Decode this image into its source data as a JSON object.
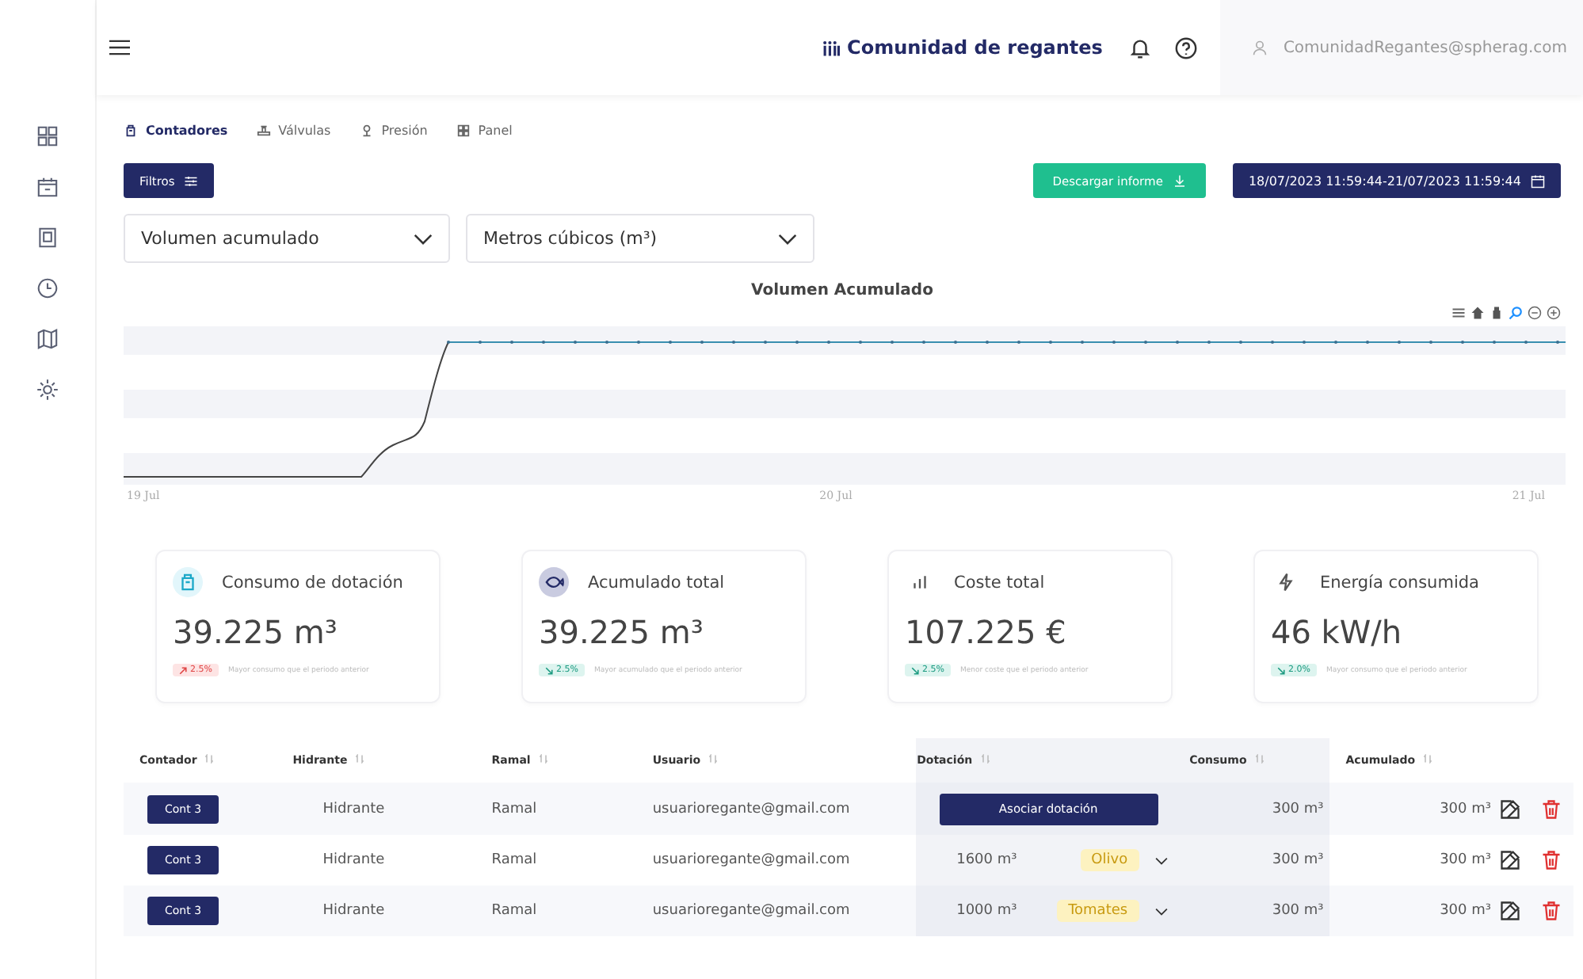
{
  "header": {
    "org": "Comunidad de regantes",
    "user": "ComunidadRegantes@spherag.com"
  },
  "tabs": [
    {
      "label": "Contadores",
      "selected": true
    },
    {
      "label": "Válvulas",
      "selected": false
    },
    {
      "label": "Presión",
      "selected": false
    },
    {
      "label": "Panel",
      "selected": false
    }
  ],
  "toolbar": {
    "filters": "Filtros",
    "download": "Descargar informe",
    "date_range": "18/07/2023 11:59:44-21/07/2023 11:59:44"
  },
  "selects": [
    {
      "value": "Volumen acumulado"
    },
    {
      "value": "Metros cúbicos (m³)"
    }
  ],
  "chart": {
    "title": "Volumen Acumulado",
    "x_labels": [
      "19 Jul",
      "20 Jul",
      "21 Jul"
    ]
  },
  "cards": [
    {
      "title": "Consumo de dotación",
      "value": "39.225 m³",
      "rising": true,
      "badge": "2.5%",
      "note": "Mayor consumo que el periodo anterior"
    },
    {
      "title": "Acumulado total",
      "value": "39.225 m³",
      "rising": false,
      "badge": "2.5%",
      "note": "Mayor acumulado que el periodo anterior"
    },
    {
      "title": "Coste total",
      "value": "107.225 €",
      "rising": false,
      "badge": "2.5%",
      "note": "Menor coste que el periodo anterior"
    },
    {
      "title": "Energía consumida",
      "value": "46 kW/h",
      "rising": false,
      "badge": "2.0%",
      "note": "Mayor consumo que el periodo anterior"
    }
  ],
  "table": {
    "columns": [
      "Contador",
      "Hidrante",
      "Ramal",
      "Usuario",
      "Dotación",
      "Consumo",
      "Acumulado"
    ],
    "rows": [
      {
        "counter": "Cont 3",
        "hydrant": "Hidrante",
        "branch": "Ramal",
        "user": "usuarioregante@gmail.com",
        "allocation": {
          "kind": "button",
          "label": "Asociar dotación"
        },
        "consumption": "300 m³",
        "accumulated": "300 m³"
      },
      {
        "counter": "Cont 3",
        "hydrant": "Hidrante",
        "branch": "Ramal",
        "user": "usuarioregante@gmail.com",
        "allocation": {
          "kind": "value",
          "amount": "1600 m³",
          "crop": "Olivo"
        },
        "consumption": "300 m³",
        "accumulated": "300 m³"
      },
      {
        "counter": "Cont 3",
        "hydrant": "Hidrante",
        "branch": "Ramal",
        "user": "usuarioregante@gmail.com",
        "allocation": {
          "kind": "value",
          "amount": "1000 m³",
          "crop": "Tomates"
        },
        "consumption": "300 m³",
        "accumulated": "300 m³"
      }
    ]
  }
}
